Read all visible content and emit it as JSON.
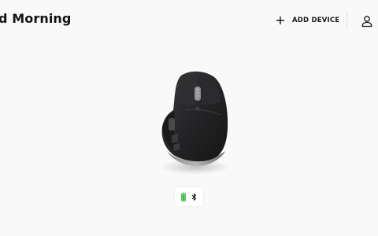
{
  "header": {
    "greeting": "d Morning",
    "add_device_label": "ADD DEVICE",
    "add_icon": "plus-icon",
    "account_icon": "user-icon"
  },
  "device": {
    "image": "mouse-image",
    "battery_icon": "battery-icon",
    "connection_icon": "bluetooth-icon",
    "battery_color": "#3dbb3d"
  },
  "colors": {
    "background": "#f9f9f9",
    "text": "#121212"
  }
}
